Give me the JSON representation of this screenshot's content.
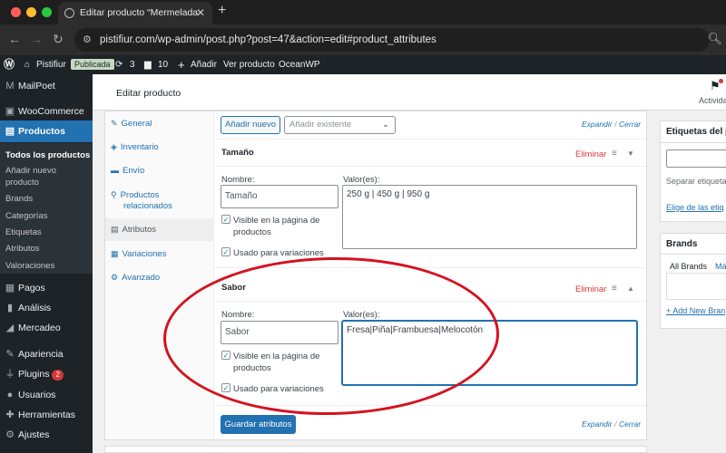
{
  "browser": {
    "tab_title": "Editar producto “Mermelada",
    "tab_close": "✕",
    "new_tab": "+",
    "url": "pistifiur.com/wp-admin/post.php?post=47&action=edit#product_attributes",
    "traffic_lights": [
      "#ff5f57",
      "#febc2e",
      "#28c840"
    ]
  },
  "adminbar": {
    "site_name": "Pistifiur",
    "status_badge": "Publicada",
    "updates_count": "3",
    "comments_count": "10",
    "add_new": "Añadir",
    "view_product": "Ver producto",
    "theme": "OceanWP"
  },
  "sidebar": {
    "items": [
      {
        "label": "MailPoet",
        "icon": "mailpoet-icon"
      },
      {
        "label": "WooCommerce",
        "icon": "woo-icon"
      },
      {
        "label": "Productos",
        "icon": "products-icon"
      },
      {
        "label": "Pagos",
        "icon": "payments-icon"
      },
      {
        "label": "Análisis",
        "icon": "analytics-icon"
      },
      {
        "label": "Mercadeo",
        "icon": "marketing-icon"
      },
      {
        "label": "Apariencia",
        "icon": "appearance-icon"
      },
      {
        "label": "Plugins",
        "icon": "plugins-icon",
        "badge": "2"
      },
      {
        "label": "Usuarios",
        "icon": "users-icon"
      },
      {
        "label": "Herramientas",
        "icon": "tools-icon"
      },
      {
        "label": "Ajustes",
        "icon": "settings-icon"
      }
    ],
    "submenu": [
      "Todos los productos",
      "Añadir nuevo producto",
      "Brands",
      "Categorías",
      "Etiquetas",
      "Atributos",
      "Valoraciones"
    ]
  },
  "header": {
    "title": "Editar producto",
    "activity": "Actividad"
  },
  "product_tabs": [
    {
      "label": "General",
      "icon": "wrench-icon"
    },
    {
      "label": "Inventario",
      "icon": "inventory-icon"
    },
    {
      "label": "Envío",
      "icon": "truck-icon"
    },
    {
      "label": "Productos relacionados",
      "icon": "link-icon"
    },
    {
      "label": "Atributos",
      "icon": "list-icon"
    },
    {
      "label": "Variaciones",
      "icon": "grid-icon"
    },
    {
      "label": "Avanzado",
      "icon": "gear-icon"
    }
  ],
  "attributes": {
    "add_new": "Añadir nuevo",
    "add_existing_placeholder": "Añadir existente",
    "expand": "Expandir",
    "collapse": "Cerrar",
    "slash": "/",
    "remove": "Eliminar",
    "name_label": "Nombre:",
    "values_label": "Valor(es):",
    "visible_label": "Visible en la página de productos",
    "variations_label": "Usado para variaciones",
    "save": "Guardar atributos",
    "items": [
      {
        "header": "Tamaño",
        "name": "Tamaño",
        "values": "250 g | 450 g | 950 g",
        "visible": true,
        "variations": true
      },
      {
        "header": "Sabor",
        "name": "Sabor",
        "values": "Fresa|Piña|Frambuesa|Melocotón",
        "visible": true,
        "variations": true
      }
    ]
  },
  "right": {
    "tags_title": "Etiquetas del p",
    "tags_help": "Separar etiqueta",
    "tags_link": "Elige de las etiq",
    "brands_title": "Brands",
    "brands_tab_all": "All Brands",
    "brands_tab_most": "Más",
    "brands_add": "+ Add New Bran"
  }
}
